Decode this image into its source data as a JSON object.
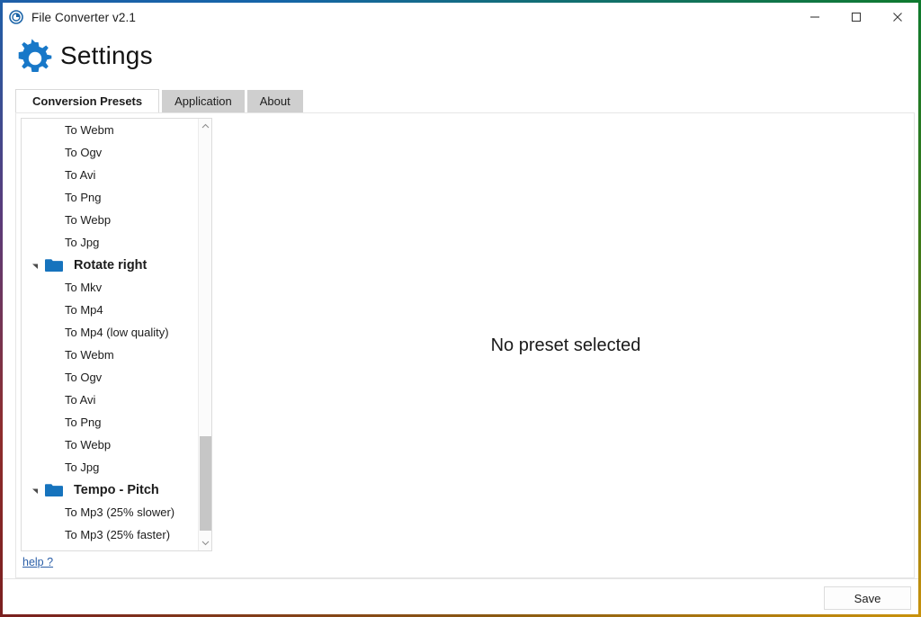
{
  "window": {
    "title": "File Converter v2.1",
    "app_icon": "app-logo-icon",
    "controls": {
      "minimize": "minimize-icon",
      "maximize": "maximize-icon",
      "close": "close-icon"
    }
  },
  "header": {
    "icon": "gear-icon",
    "title": "Settings",
    "accent_color": "#1878c8"
  },
  "tabs": [
    {
      "label": "Conversion Presets",
      "active": true
    },
    {
      "label": "Application",
      "active": false
    },
    {
      "label": "About",
      "active": false
    }
  ],
  "tree": {
    "scrollbar": {
      "up_arrow": "chevron-up-icon",
      "down_arrow": "chevron-down-icon",
      "thumb_position": "near-bottom"
    },
    "rows": [
      {
        "type": "leaf",
        "label": "To Webm"
      },
      {
        "type": "leaf",
        "label": "To Ogv"
      },
      {
        "type": "leaf",
        "label": "To Avi"
      },
      {
        "type": "leaf",
        "label": "To Png"
      },
      {
        "type": "leaf",
        "label": "To Webp"
      },
      {
        "type": "leaf",
        "label": "To Jpg"
      },
      {
        "type": "group",
        "label": "Rotate right",
        "expanded": true
      },
      {
        "type": "leaf",
        "label": "To Mkv"
      },
      {
        "type": "leaf",
        "label": "To Mp4"
      },
      {
        "type": "leaf",
        "label": "To Mp4 (low quality)"
      },
      {
        "type": "leaf",
        "label": "To Webm"
      },
      {
        "type": "leaf",
        "label": "To Ogv"
      },
      {
        "type": "leaf",
        "label": "To Avi"
      },
      {
        "type": "leaf",
        "label": "To Png"
      },
      {
        "type": "leaf",
        "label": "To Webp"
      },
      {
        "type": "leaf",
        "label": "To Jpg"
      },
      {
        "type": "group",
        "label": "Tempo - Pitch",
        "expanded": true
      },
      {
        "type": "leaf",
        "label": "To Mp3 (25% slower)"
      },
      {
        "type": "leaf",
        "label": "To Mp3 (25% faster)"
      }
    ]
  },
  "detail": {
    "placeholder": "No preset selected"
  },
  "help": {
    "label": "help ?",
    "color": "#2b5fa8"
  },
  "footer": {
    "save_label": "Save"
  }
}
